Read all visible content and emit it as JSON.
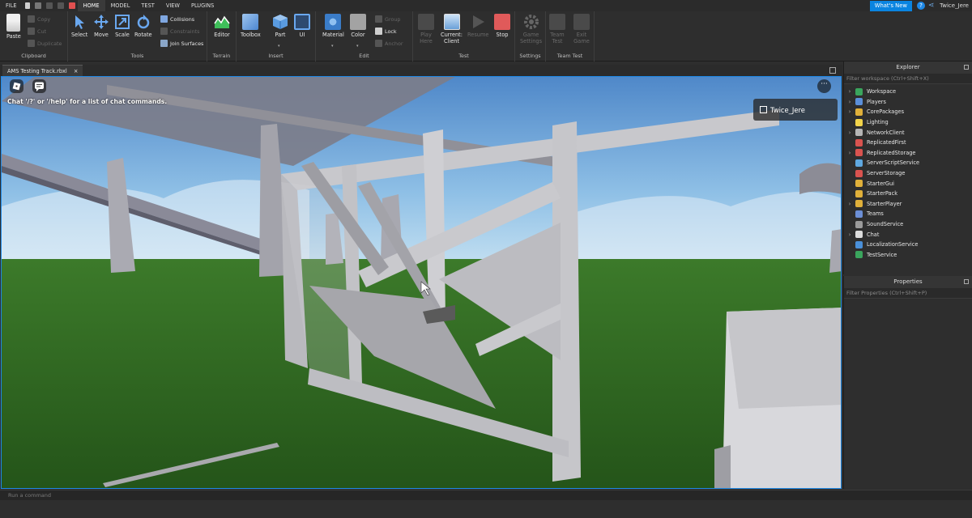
{
  "menu": {
    "items": [
      "FILE",
      "HOME",
      "MODEL",
      "TEST",
      "VIEW",
      "PLUGINS"
    ],
    "active": "HOME"
  },
  "topbar": {
    "whats_new": "What's New",
    "username": "Twice_Jere"
  },
  "ribbon": {
    "clipboard": {
      "label": "Clipboard",
      "paste": "Paste",
      "copy": "Copy",
      "cut": "Cut",
      "duplicate": "Duplicate"
    },
    "tools": {
      "label": "Tools",
      "select": "Select",
      "move": "Move",
      "scale": "Scale",
      "rotate": "Rotate",
      "collisions": "Collisions",
      "constraints": "Constraints",
      "join_surfaces": "Join Surfaces"
    },
    "terrain": {
      "label": "Terrain",
      "editor": "Editor"
    },
    "insert": {
      "label": "Insert",
      "toolbox": "Toolbox",
      "part": "Part",
      "ui": "UI"
    },
    "edit": {
      "label": "Edit",
      "material": "Material",
      "color": "Color",
      "group": "Group",
      "lock": "Lock",
      "anchor": "Anchor"
    },
    "test": {
      "label": "Test",
      "play_here_1": "Play",
      "play_here_2": "Here",
      "current_1": "Current:",
      "current_2": "Client",
      "resume": "Resume",
      "stop": "Stop"
    },
    "settings": {
      "label": "Settings",
      "game_settings_1": "Game",
      "game_settings_2": "Settings"
    },
    "team_test": {
      "label": "Team Test",
      "team_test_1": "Team",
      "team_test_2": "Test",
      "exit_game_1": "Exit",
      "exit_game_2": "Game"
    }
  },
  "document": {
    "tab_title": "AMS Testing Track.rbxl"
  },
  "viewport": {
    "chat_hint": "Chat '/?' or '/help' for a list of chat commands.",
    "player_name": "Twice_Jere"
  },
  "explorer": {
    "title": "Explorer",
    "filter_placeholder": "Filter workspace (Ctrl+Shift+X)",
    "items": [
      {
        "label": "Workspace",
        "expandable": true,
        "icon_color": "#3aa55d"
      },
      {
        "label": "Players",
        "expandable": true,
        "icon_color": "#5b8fd9"
      },
      {
        "label": "CorePackages",
        "expandable": true,
        "icon_color": "#e0b03a"
      },
      {
        "label": "Lighting",
        "expandable": false,
        "icon_color": "#f2d34a"
      },
      {
        "label": "NetworkClient",
        "expandable": true,
        "icon_color": "#b5b5b5"
      },
      {
        "label": "ReplicatedFirst",
        "expandable": false,
        "icon_color": "#d9534f"
      },
      {
        "label": "ReplicatedStorage",
        "expandable": true,
        "icon_color": "#d9534f"
      },
      {
        "label": "ServerScriptService",
        "expandable": false,
        "icon_color": "#5fa8e0"
      },
      {
        "label": "ServerStorage",
        "expandable": false,
        "icon_color": "#d9534f"
      },
      {
        "label": "StarterGui",
        "expandable": false,
        "icon_color": "#e0b03a"
      },
      {
        "label": "StarterPack",
        "expandable": false,
        "icon_color": "#e0b03a"
      },
      {
        "label": "StarterPlayer",
        "expandable": true,
        "icon_color": "#e0b03a"
      },
      {
        "label": "Teams",
        "expandable": false,
        "icon_color": "#6c8fd6"
      },
      {
        "label": "SoundService",
        "expandable": false,
        "icon_color": "#9a9a9a"
      },
      {
        "label": "Chat",
        "expandable": true,
        "icon_color": "#dcdcdc"
      },
      {
        "label": "LocalizationService",
        "expandable": false,
        "icon_color": "#4a90d9"
      },
      {
        "label": "TestService",
        "expandable": false,
        "icon_color": "#3aa55d"
      }
    ]
  },
  "properties": {
    "title": "Properties",
    "filter_placeholder": "Filter Properties (Ctrl+Shift+P)"
  },
  "command_bar": {
    "placeholder": "Run a command"
  }
}
